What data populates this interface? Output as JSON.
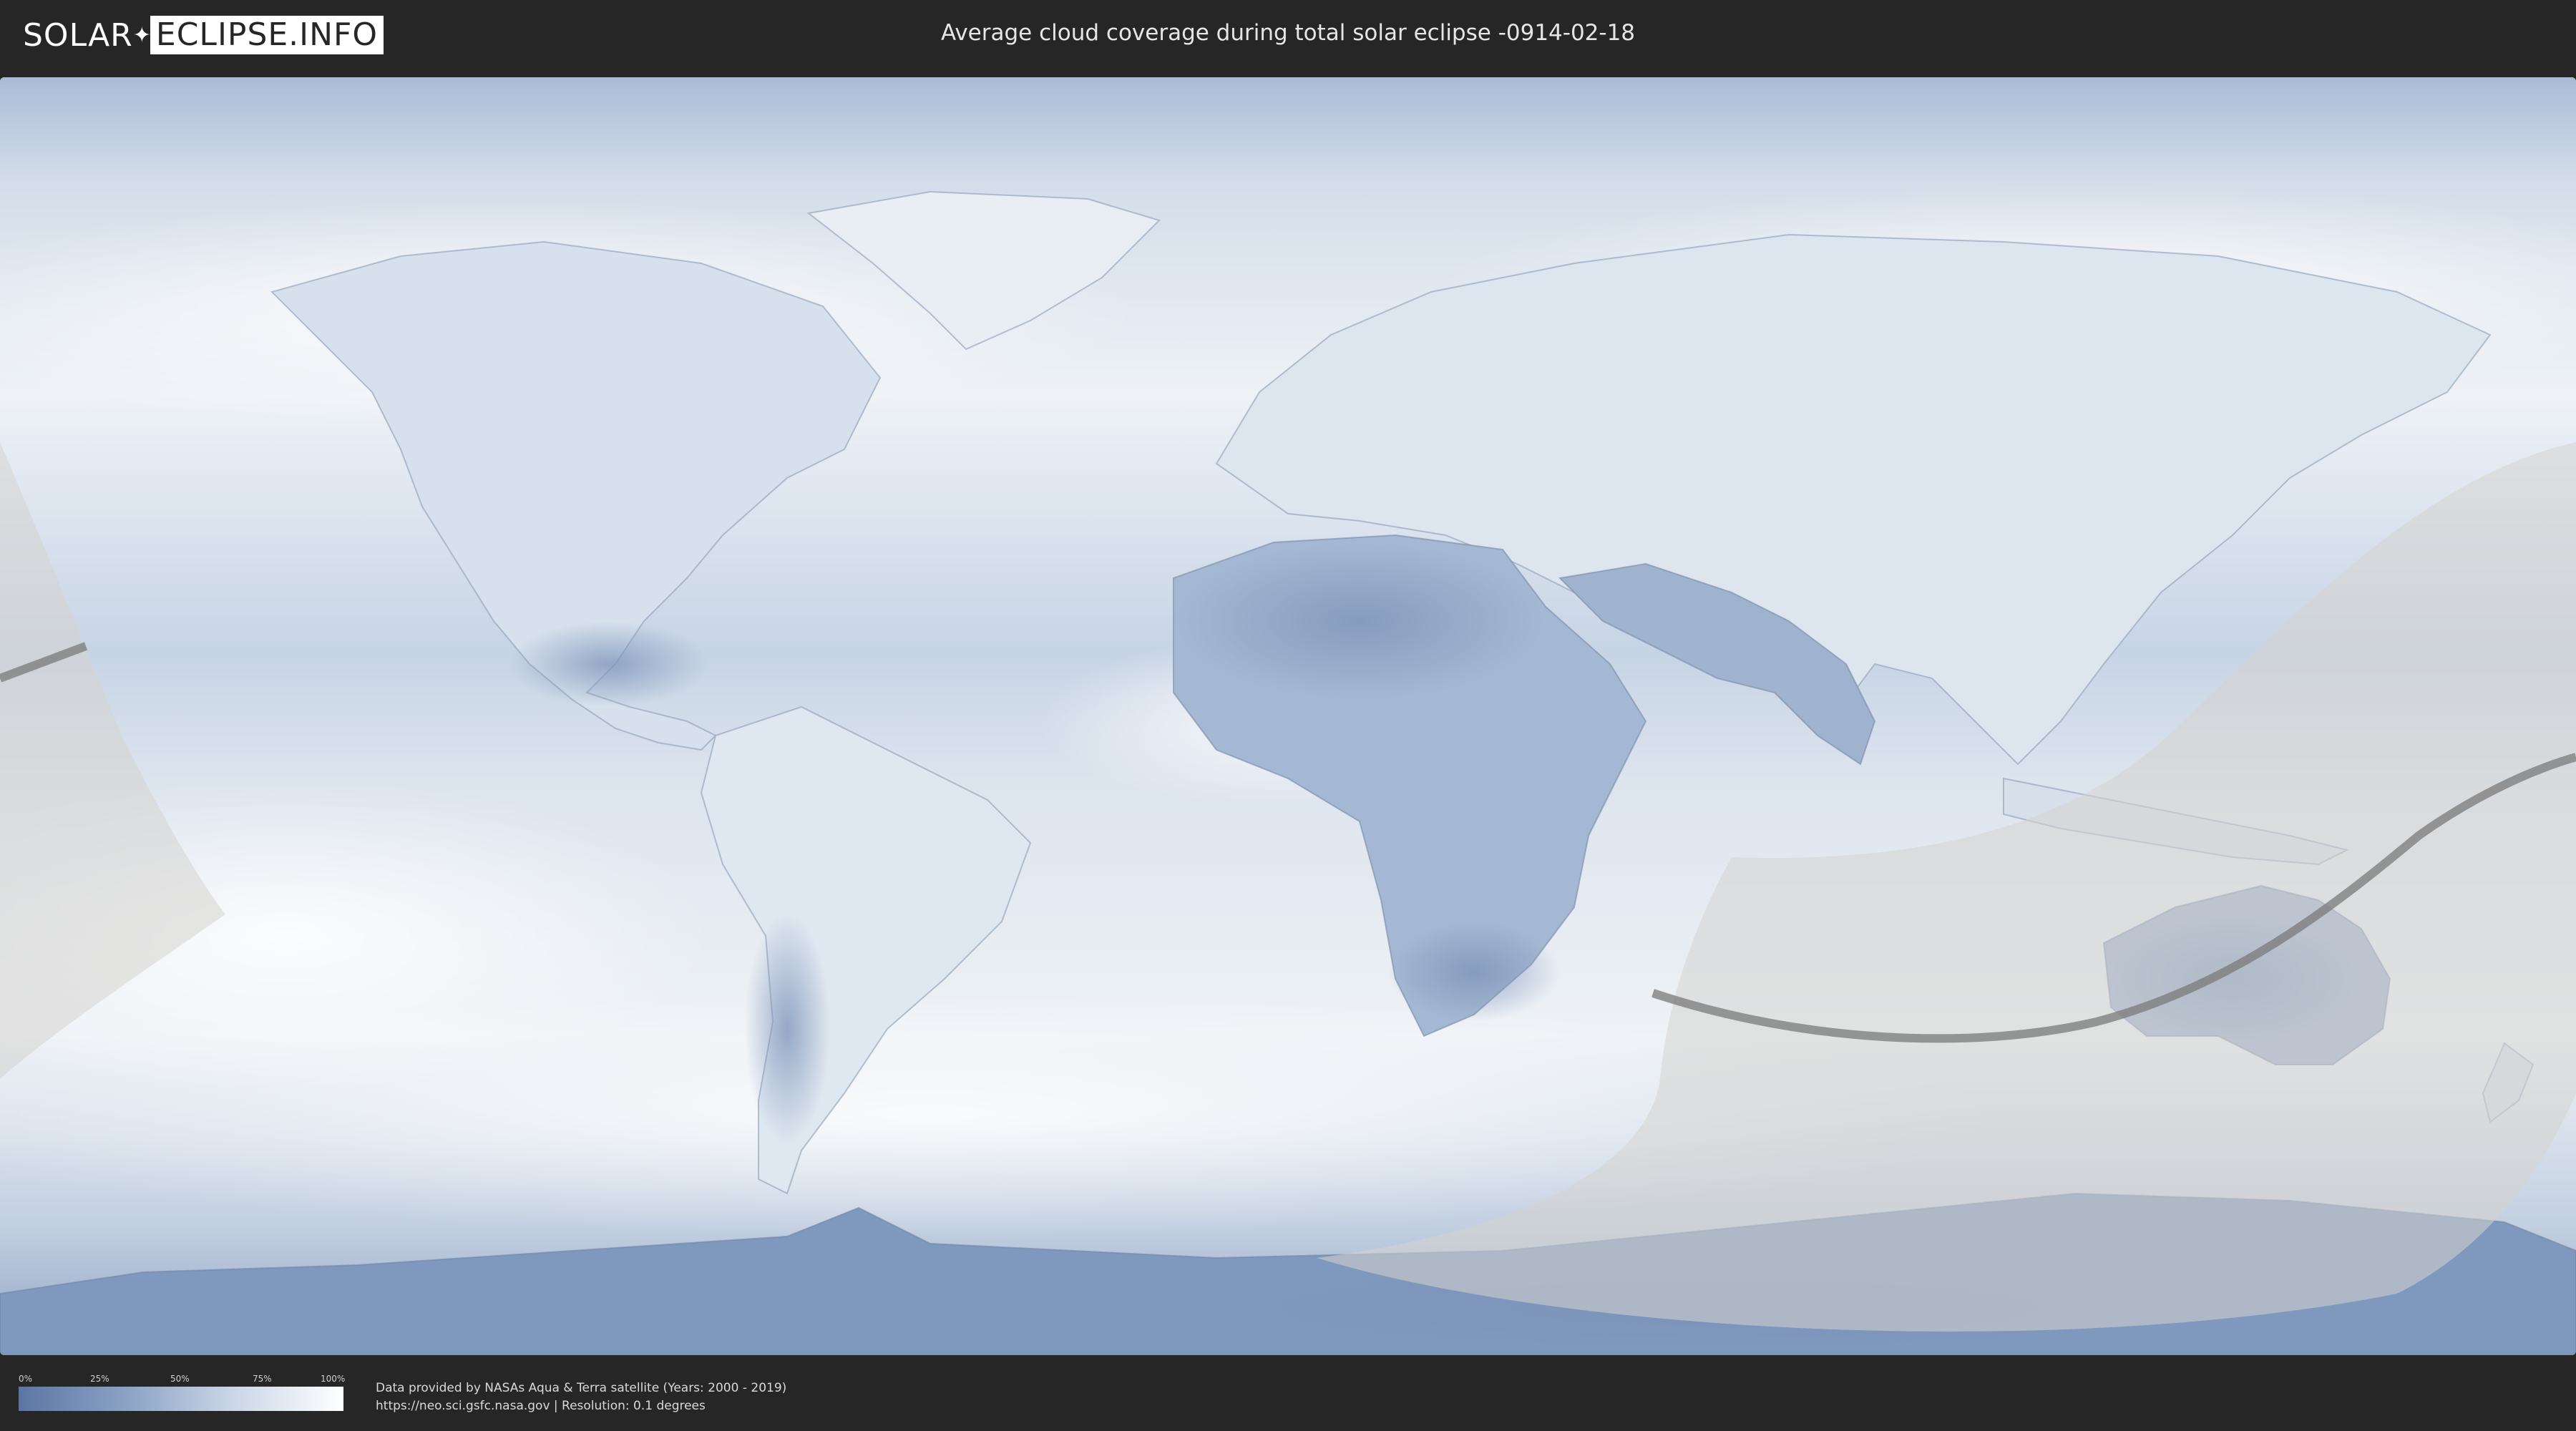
{
  "header": {
    "logo_left": "SOLAR",
    "logo_right": "ECLIPSE.INFO",
    "title": "Average cloud coverage during total solar eclipse -0914-02-18"
  },
  "map": {
    "colors": {
      "clear_sky": "#5c76a3",
      "full_cloud": "#ffffff",
      "eclipse_zone": "#d6d3cf",
      "central_line": "#7a7a7a"
    }
  },
  "legend": {
    "ticks": [
      "0%",
      "25%",
      "50%",
      "75%",
      "100%"
    ]
  },
  "footer": {
    "credit_line1": "Data provided by NASAs Aqua & Terra satellite (Years: 2000 - 2019)",
    "credit_line2": "https://neo.sci.gsfc.nasa.gov | Resolution: 0.1 degrees"
  }
}
